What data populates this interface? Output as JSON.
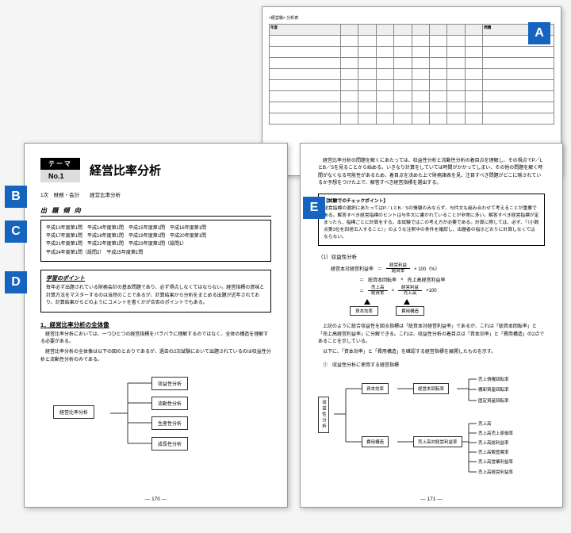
{
  "markers": {
    "A": "A",
    "B": "B",
    "C": "C",
    "D": "D",
    "E": "E"
  },
  "top_page": {
    "title": "<経営戦> 分析表",
    "headers": [
      "年度",
      "",
      "",
      "",
      "",
      "",
      "",
      "",
      "",
      "問題"
    ],
    "rows": 8
  },
  "left": {
    "theme_tag": "テーマ",
    "theme_no": "No.1",
    "theme_title": "経営比率分析",
    "crumb": "1次　財務・会計　　経営比率分析",
    "exam_head": "出 題 傾 向",
    "exam_lines": [
      "平成13年度第1問　平成14年度第1問　平成15年度第1問　平成16年度第1問",
      "平成17年度第1問　平成18年度第1問　平成19年度第1問　平成20年度第1問",
      "平成21年度第1問　平成22年度第1問　平成23年度第1問（設問1）",
      "平成24年度第1問（設問2）　平成25年度第1問"
    ],
    "study_head": "学習のポイント",
    "study_body": "毎年必ず出題されている財務会計の基本問題であり、必ず得点しなくてはならない。経営指標の意味と計算方法をマスターするのは当然のことであるが、計算結果から分析をまとめる出題が近年されており、計算結果からどのようにコメントを書くかが合否のポイントでもある。",
    "sec1_title": "1．経営比率分析の全体像",
    "sec1_p1": "経営比率分析においては、一つひとつの経営指標をバラバラに理解するのではなく、全体の構造を理解する必要がある。",
    "sec1_p2": "経営比率分析の全体像は以下の図のとおりであるが、過去の2次試験において出題されているのは収益性分析と流動性分析のみである。",
    "tree": {
      "root": "経営比率分析",
      "children": [
        "収益性分析",
        "流動性分析",
        "生産性分析",
        "成長性分析"
      ]
    },
    "page_no": "― 170 ―"
  },
  "right": {
    "intro": "経営比率分析の問題を解くにあたっては、収益性分析と流動性分析の着目点を理解し、その視点でP／LとB／Sを見ることから始める。いきなり計算をしていては時間がかかってしまい、その他の問題を解く時間がなくなる可能性があるため、着目点を決めた上で財務諸表を見、注目すべき問題がどこに隠されているか予想をつけた上で、解答すべき経営指標を選出する。",
    "check_head": "【試験でのチェックポイント】",
    "check_body": "経営指標の選択にあたってはP／LとB／Sの情報のみならず、与件文も組み合わせて考えることが重要である。解答すべき経営指標のヒントは与件文に書かれていることが非常に多い。解答すべき経営指標が定まったら、指標ごとに計算をする。本試験ではこの考え方が必要である。計算に際しては、必ず、「（小数点第3位を四捨五入すること）」のような注釈中の条件を確認し、出題者の指示どおりに計算しなくてはならない。",
    "sec_h": "（1）収益性分析",
    "f_lhs": "経営本対経営利益率",
    "f_eq": "＝",
    "f_num": "経営利益",
    "f_den": "総資本",
    "f_tail": "× 100（%）",
    "f2_a": "総資本回転率",
    "f2_b": "売上高経営利益率",
    "f3_a_num": "売上高",
    "f3_a_den": "総資本",
    "f3_b_num": "経営利益",
    "f3_b_den": "売上高",
    "box_a": "資本効率",
    "box_b": "費用構造",
    "p_after": "上記のように総合収益性を図る指標は「総資本対経営利益率」であるが、これは「総資本回転率」と「売上高経営利益率」に分解できる。これは、収益性分析の着目点は「資本効率」と「費用構造」の2点であることを示している。",
    "p_after2": "以下に、「資本効率」と「費用構造」を確認する経営指標を展開したものを示す。",
    "p_tree_head": "①　収益性分析に使用する経営指標",
    "tree2": {
      "root": "収益性分析",
      "b1": "資本効率",
      "b1_l": "経営本回転率",
      "b1_leaves": [
        "売上債権回転率",
        "棚卸資産回転率",
        "固定資産回転率"
      ],
      "b2": "費用構造",
      "b2_l": "売上高対経営利益率",
      "b2_leaves": [
        "売上高",
        "売上高売上原価率",
        "売上高総利益率",
        "売上高販管費率",
        "売上高営業利益率",
        "売上高経営利益率"
      ]
    },
    "page_no": "― 171 ―"
  }
}
